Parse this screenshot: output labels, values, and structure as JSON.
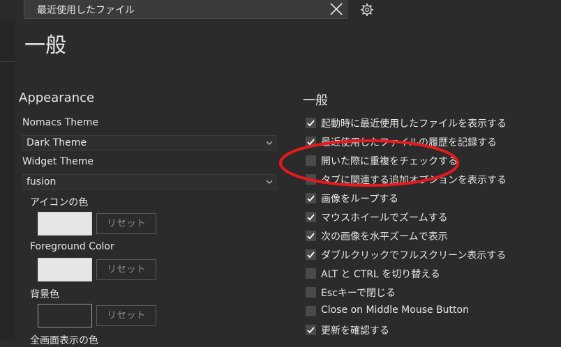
{
  "topbar": {
    "tab_label": "最近使用したファイル",
    "icons": [
      "close-icon",
      "gear-icon"
    ]
  },
  "page": {
    "title": "一般"
  },
  "appearance": {
    "section_title": "Appearance",
    "nomacs_theme": {
      "label": "Nomacs  Theme",
      "value": "Dark Theme"
    },
    "widget_theme": {
      "label": "Widget Theme",
      "value": "fusion"
    },
    "colors": [
      {
        "label": "アイコンの色",
        "swatch": "#e6e6e6",
        "reset": "リセット"
      },
      {
        "label": "Foreground Color",
        "swatch": "#e6e6e6",
        "reset": "リセット"
      },
      {
        "label": "背景色",
        "swatch": "empty",
        "reset": "リセット"
      }
    ],
    "next_label": "全画面表示の色"
  },
  "general": {
    "section_title": "一般",
    "options": [
      {
        "label": "起動時に最近使用したファイルを表示する",
        "checked": true
      },
      {
        "label": "最近使用したファイルの履歴を記録する",
        "checked": true
      },
      {
        "label": "開いた際に重複をチェックする",
        "checked": false
      },
      {
        "label": "タブに関連する追加オプションを表示する",
        "checked": false
      },
      {
        "label": "画像をループする",
        "checked": true
      },
      {
        "label": "マウスホイールでズームする",
        "checked": true
      },
      {
        "label": "次の画像を水平ズームで表示",
        "checked": true
      },
      {
        "label": "ダブルクリックでフルスクリーン表示する",
        "checked": true
      },
      {
        "label": "ALT と CTRL を切り替える",
        "checked": false
      },
      {
        "label": "Escキーで閉じる",
        "checked": false
      },
      {
        "label": "Close on Middle Mouse Button",
        "checked": false
      },
      {
        "label": "更新を確認する",
        "checked": true
      }
    ]
  },
  "annotation": {
    "color": "#e8191d",
    "highlighted_option": 2
  }
}
